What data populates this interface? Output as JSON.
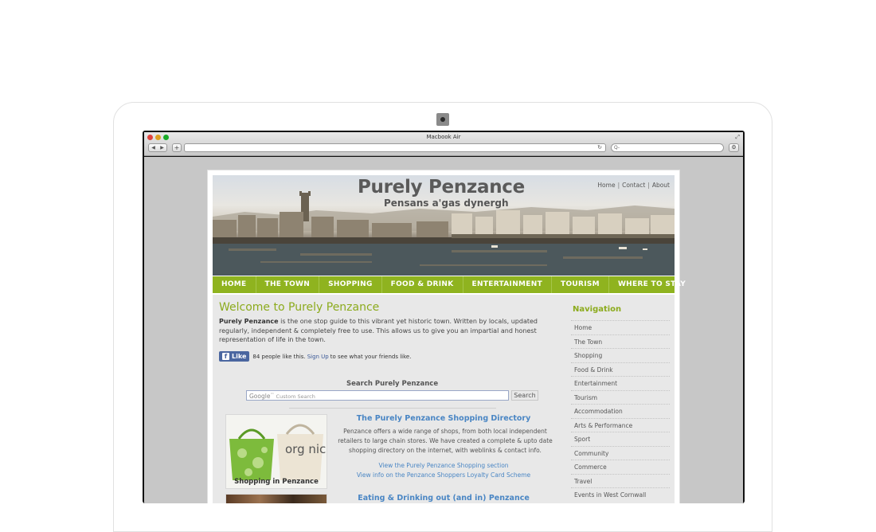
{
  "browser": {
    "window_title": "Macbook Air",
    "search_placeholder": "Q-"
  },
  "site": {
    "title": "Purely Penzance",
    "subtitle": "Pensans a'gas dynergh",
    "toplinks": [
      "Home",
      "Contact",
      "About"
    ],
    "menu": [
      "HOME",
      "THE TOWN",
      "SHOPPING",
      "FOOD & DRINK",
      "ENTERTAINMENT",
      "TOURISM",
      "WHERE TO STAY"
    ]
  },
  "main": {
    "welcome": "Welcome to Purely Penzance",
    "intro_bold": "Purely Penzance",
    "intro_text": " is the one stop guide to this vibrant yet historic town. Written by locals, updated regularly, independent & completely free to use. This allows us to give you an impartial and honest representation of life in the town.",
    "like_label": "Like",
    "like_count_text": "84 people like this.",
    "like_signup": "Sign Up",
    "like_suffix": "to see what your friends like.",
    "search_title": "Search Purely Penzance",
    "search_google": "Google",
    "search_placeholder": "Custom Search",
    "search_button": "Search",
    "shopping": {
      "title": "The Purely Penzance Shopping Directory",
      "text": "Penzance offers a wide range of shops, from both local independent retailers to large chain stores. We have created a complete & upto date shopping directory on the internet, with weblinks & contact info.",
      "link1": "View the Purely Penzance Shopping section",
      "link2": "View info on the Penzance Shoppers Loyalty Card Scheme",
      "image_caption": "Shopping in Penzance",
      "bag_text": "org nic"
    },
    "food": {
      "title": "Eating & Drinking out (and in) Penzance"
    }
  },
  "sidebar": {
    "title": "Navigation",
    "items": [
      "Home",
      "The Town",
      "Shopping",
      "Food & Drink",
      "Entertainment",
      "Tourism",
      "Accommodation",
      "Arts & Performance",
      "Sport",
      "Community",
      "Commerce",
      "Travel",
      "Events in West Cornwall"
    ]
  },
  "colors": {
    "accent_green": "#8cab1d",
    "menu_green": "#8fb31f",
    "link_blue": "#4a86c4"
  }
}
